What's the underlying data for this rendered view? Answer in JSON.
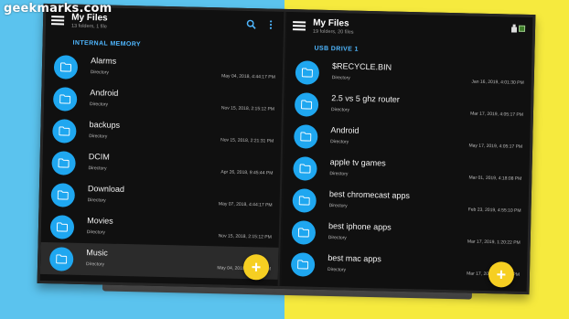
{
  "watermark": "geekmarks.com",
  "left_pane": {
    "title": "My Files",
    "subtitle": "13 folders, 1 file",
    "section": "INTERNAL MEMORY",
    "items": [
      {
        "name": "Alarms",
        "kind": "Directory",
        "date": "May 04, 2018, 4:44:17 PM"
      },
      {
        "name": "Android",
        "kind": "Directory",
        "date": "Nov 15, 2018, 2:15:12 PM"
      },
      {
        "name": "backups",
        "kind": "Directory",
        "date": "Nov 15, 2018, 2:21:31 PM"
      },
      {
        "name": "DCIM",
        "kind": "Directory",
        "date": "Apr 26, 2018, 9:45:44 PM"
      },
      {
        "name": "Download",
        "kind": "Directory",
        "date": "May 07, 2018, 4:44:17 PM"
      },
      {
        "name": "Movies",
        "kind": "Directory",
        "date": "Nov 15, 2018, 2:15:12 PM"
      },
      {
        "name": "Music",
        "kind": "Directory",
        "date": "May 04, 2018, 4:44:17 PM"
      }
    ]
  },
  "right_pane": {
    "title": "My Files",
    "subtitle": "19 folders, 20 files",
    "section": "USB DRIVE 1",
    "items": [
      {
        "name": "$RECYCLE.BIN",
        "kind": "Directory",
        "date": "Jan 16, 2019, 4:01:30 PM"
      },
      {
        "name": "2.5 vs 5 ghz router",
        "kind": "Directory",
        "date": "Mar 17, 2019, 4:05:17 PM"
      },
      {
        "name": "Android",
        "kind": "Directory",
        "date": "May 17, 2019, 4:05:17 PM"
      },
      {
        "name": "apple tv games",
        "kind": "Directory",
        "date": "Mar 01, 2019, 4:18:08 PM"
      },
      {
        "name": "best chromecast apps",
        "kind": "Directory",
        "date": "Feb 23, 2019, 4:55:10 PM"
      },
      {
        "name": "best iphone apps",
        "kind": "Directory",
        "date": "Mar 17, 2019, 1:20:22 PM"
      },
      {
        "name": "best mac apps",
        "kind": "Directory",
        "date": "Mar 17, 2019, 4:05:17 PM"
      }
    ]
  },
  "fab_label": "+",
  "colors": {
    "accent": "#1fa7f0",
    "fab": "#f6cf22",
    "section": "#4fb7ff"
  }
}
